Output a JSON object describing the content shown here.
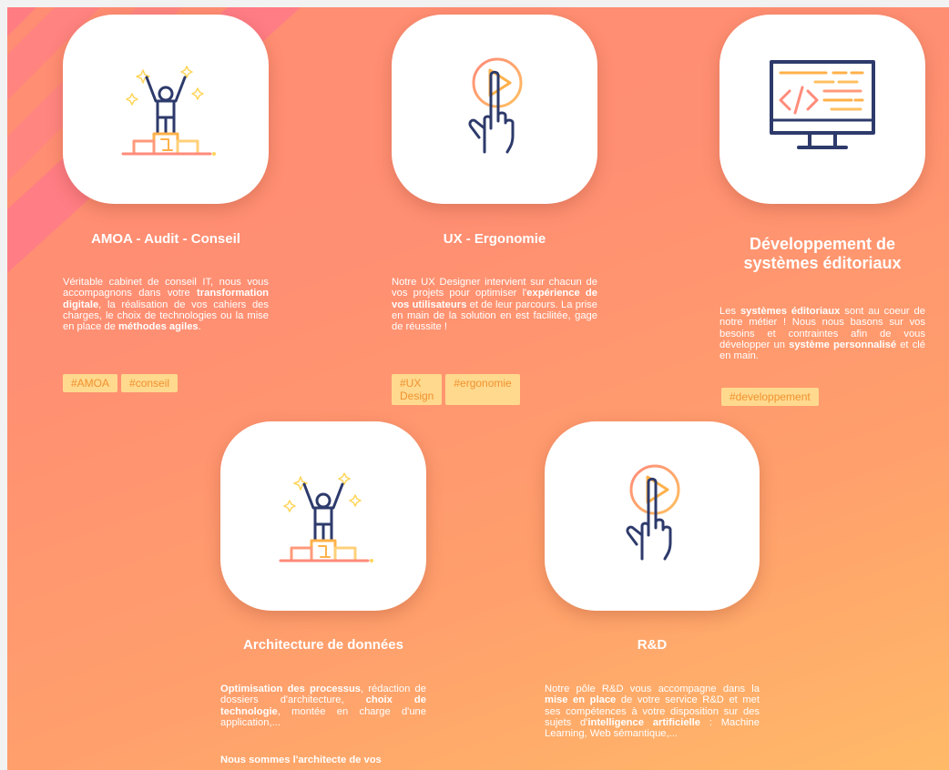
{
  "cards": [
    {
      "title": "AMOA - Audit - Conseil",
      "icon": "podium-winner-icon",
      "description": [
        {
          "t": "Véritable cabinet de conseil IT, nous vous accompagnons dans votre ",
          "b": false
        },
        {
          "t": "transformation digitale",
          "b": true
        },
        {
          "t": ", la réalisation de vos cahiers des charges, le choix de technologies ou la mise en place de ",
          "b": false
        },
        {
          "t": "méthodes agiles",
          "b": true
        },
        {
          "t": ".",
          "b": false
        }
      ],
      "tags": [
        "#AMOA",
        "#conseil"
      ]
    },
    {
      "title": "UX - Ergonomie",
      "icon": "touch-play-icon",
      "description": [
        {
          "t": "Notre UX Designer intervient sur chacun de vos projets pour optimiser l'",
          "b": false
        },
        {
          "t": "expérience de vos utilisateurs",
          "b": true
        },
        {
          "t": " et de leur parcours.  La prise en main de la solution en est facilitée, gage de réussite !",
          "b": false
        }
      ],
      "tags": [
        "#UX Design",
        "#ergonomie"
      ]
    },
    {
      "title": "Développement de systèmes éditoriaux",
      "icon": "code-monitor-icon",
      "description": [
        {
          "t": "Les ",
          "b": false
        },
        {
          "t": "systèmes éditoriaux",
          "b": true
        },
        {
          "t": " sont au coeur de notre métier ! Nous nous basons sur vos besoins et contraintes afin de vous développer un ",
          "b": false
        },
        {
          "t": "système personnalisé",
          "b": true
        },
        {
          "t": " et clé en main.",
          "b": false
        }
      ],
      "tags": [
        "#developpement"
      ]
    },
    {
      "title": "Architecture de données",
      "icon": "podium-winner-icon",
      "description": [
        {
          "t": "Optimisation des processus",
          "b": true
        },
        {
          "t": ", rédaction de dossiers d'architecture, ",
          "b": false
        },
        {
          "t": "choix de technologie",
          "b": true
        },
        {
          "t": ", montée en charge d'une application,...",
          "b": false
        }
      ],
      "description2": [
        {
          "t": "Nous sommes l'architecte de vos",
          "b": true
        }
      ],
      "tags": []
    },
    {
      "title": "R&D",
      "icon": "touch-play-icon",
      "description": [
        {
          "t": "Notre pôle R&D vous accompagne dans la ",
          "b": false
        },
        {
          "t": "mise en place",
          "b": true
        },
        {
          "t": " de votre service R&D et met ses compétences à votre disposition sur des sujets d'",
          "b": false
        },
        {
          "t": "intelligence artificielle",
          "b": true
        },
        {
          "t": " : Machine Learning, Web sémantique,...",
          "b": false
        }
      ],
      "tags": []
    }
  ]
}
